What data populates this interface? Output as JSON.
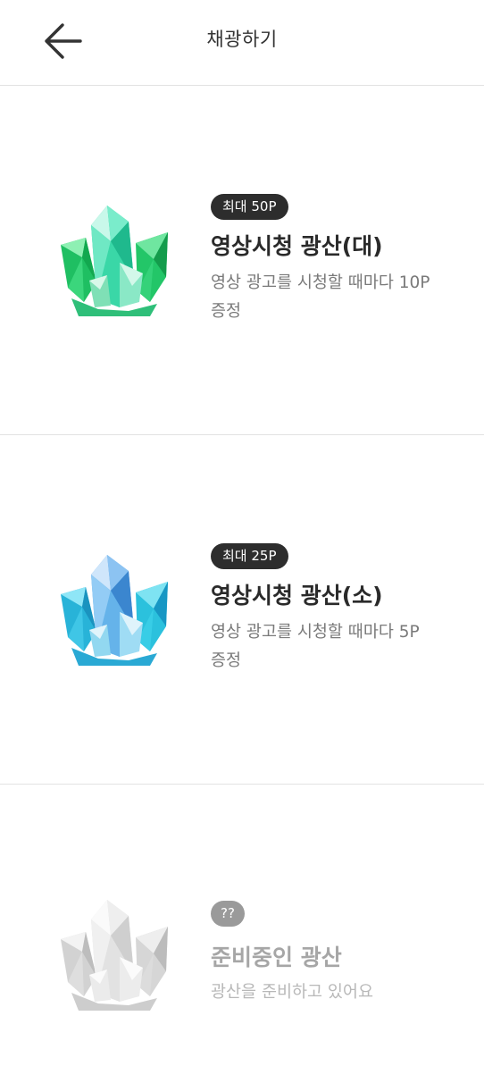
{
  "header": {
    "title": "채광하기",
    "back_icon": "arrow-left-icon"
  },
  "cards": [
    {
      "badge": "최대 50P",
      "title": "영상시청 광산(대)",
      "description": "영상 광고를 시청할 때마다 10P 증정",
      "gem_icon": "green-crystal-icon",
      "color": "#22c56a"
    },
    {
      "badge": "최대 25P",
      "title": "영상시청 광산(소)",
      "description": "영상 광고를 시청할 때마다 5P 증정",
      "gem_icon": "blue-crystal-icon",
      "color": "#2fb6e6"
    },
    {
      "badge": "??",
      "title": "준비중인 광산",
      "description": "광산을 준비하고 있어요",
      "gem_icon": "gray-crystal-icon",
      "color": "#d6d6d6"
    }
  ]
}
